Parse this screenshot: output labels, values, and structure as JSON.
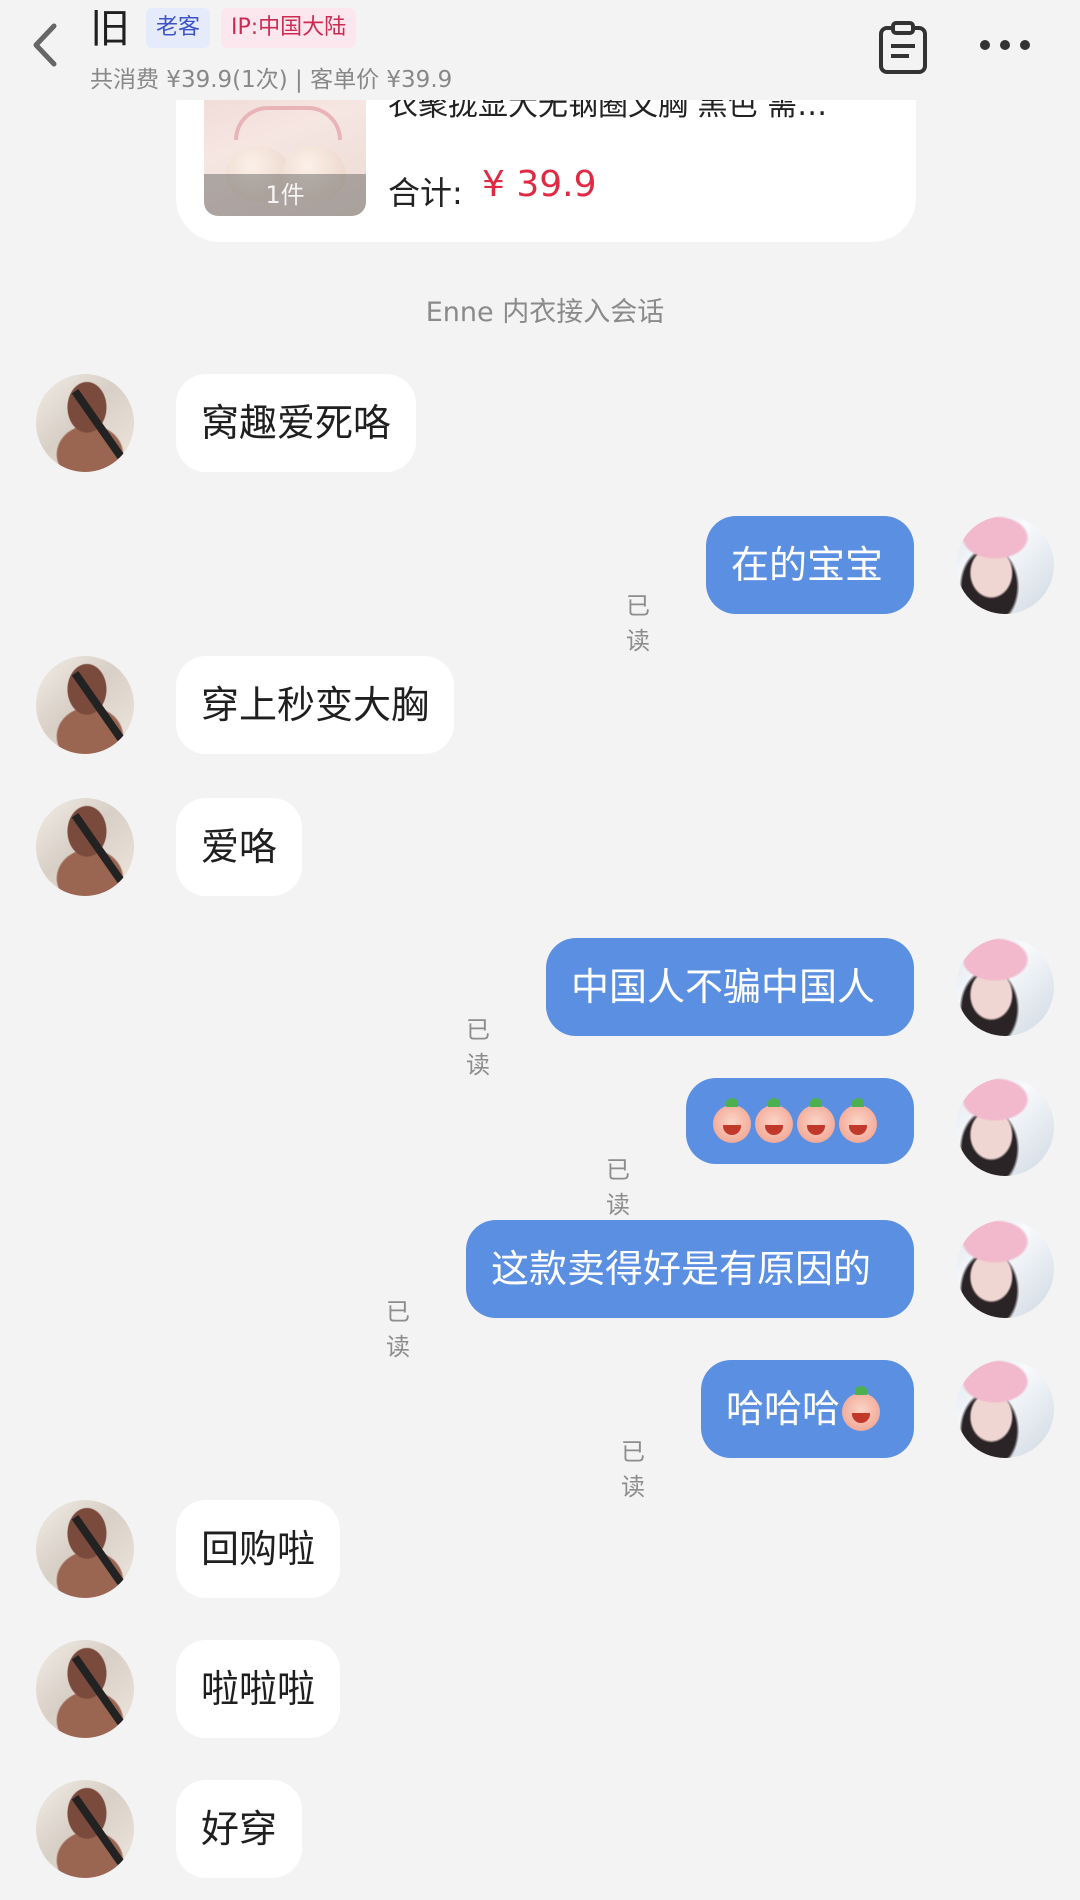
{
  "header": {
    "title": "旧",
    "tags": [
      "老客",
      "IP:中国大陆"
    ],
    "subinfo": "共消费 ¥39.9(1次) | 客单价 ¥39.9"
  },
  "order": {
    "product_name": "衣聚拢显大无钢圈文胸 黑色 需…",
    "quantity": "1件",
    "total_label": "合计:",
    "total_value": "¥ 39.9"
  },
  "system_message": "Enne 内衣接入会话",
  "messages": [
    {
      "from": "customer",
      "text": "窝趣爱死咯"
    },
    {
      "from": "agent",
      "text": "在的宝宝",
      "status": "已读"
    },
    {
      "from": "customer",
      "text": "穿上秒变大胸"
    },
    {
      "from": "customer",
      "text": "爱咯"
    },
    {
      "from": "agent",
      "text": "中国人不骗中国人",
      "status": "已读"
    },
    {
      "from": "agent",
      "text": "",
      "status": "已读",
      "emoji": "peach-face-emoji",
      "emoji_count": 4
    },
    {
      "from": "agent",
      "text": "这款卖得好是有原因的",
      "status": "已读"
    },
    {
      "from": "agent",
      "text": "哈哈哈",
      "status": "已读",
      "emoji": "peach-laugh-emoji"
    },
    {
      "from": "customer",
      "text": "回购啦"
    },
    {
      "from": "customer",
      "text": "啦啦啦"
    },
    {
      "from": "customer",
      "text": "好穿"
    }
  ],
  "colors": {
    "agent_bubble": "#5b8fe1",
    "customer_bubble": "#ffffff",
    "price": "#e02a44",
    "background": "#f3f3f3"
  }
}
